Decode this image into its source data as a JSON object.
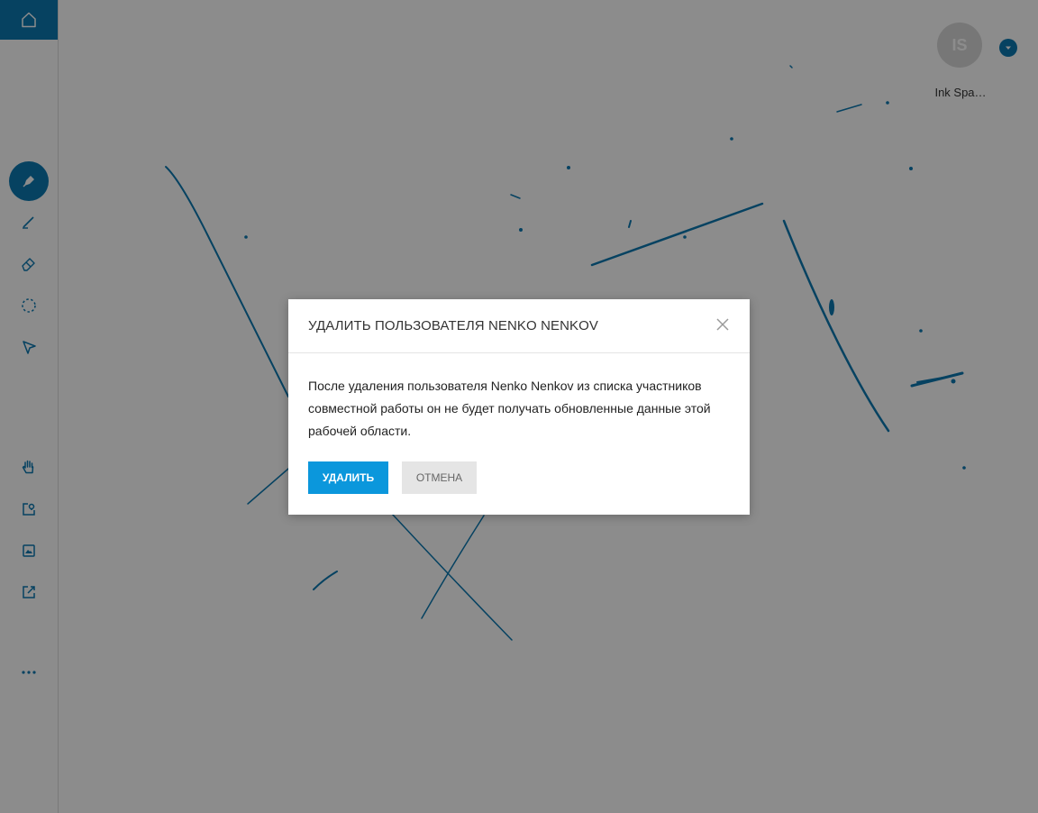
{
  "user": {
    "initials": "IS",
    "name": "Ink Spa…"
  },
  "sidebar": {
    "tools": [
      {
        "name": "pen-icon",
        "active": true
      },
      {
        "name": "highlighter-icon"
      },
      {
        "name": "eraser-icon"
      },
      {
        "name": "lasso-icon"
      },
      {
        "name": "pointer-icon"
      },
      {
        "name": "hand-icon"
      },
      {
        "name": "insert-image-icon"
      },
      {
        "name": "gallery-icon"
      },
      {
        "name": "share-icon"
      },
      {
        "name": "more-icon"
      }
    ]
  },
  "dialog": {
    "title": "УДАЛИТЬ ПОЛЬЗОВАТЕЛЯ NENKO NENKOV",
    "body": "После удаления пользователя Nenko Nenkov из списка участников совместной работы он не будет получать обновленные данные этой рабочей области.",
    "confirm_label": "УДАЛИТЬ",
    "cancel_label": "ОТМЕНА"
  },
  "colors": {
    "accent": "#0b78b1",
    "button_primary": "#0b97dc",
    "ink": "#0b78b1"
  }
}
